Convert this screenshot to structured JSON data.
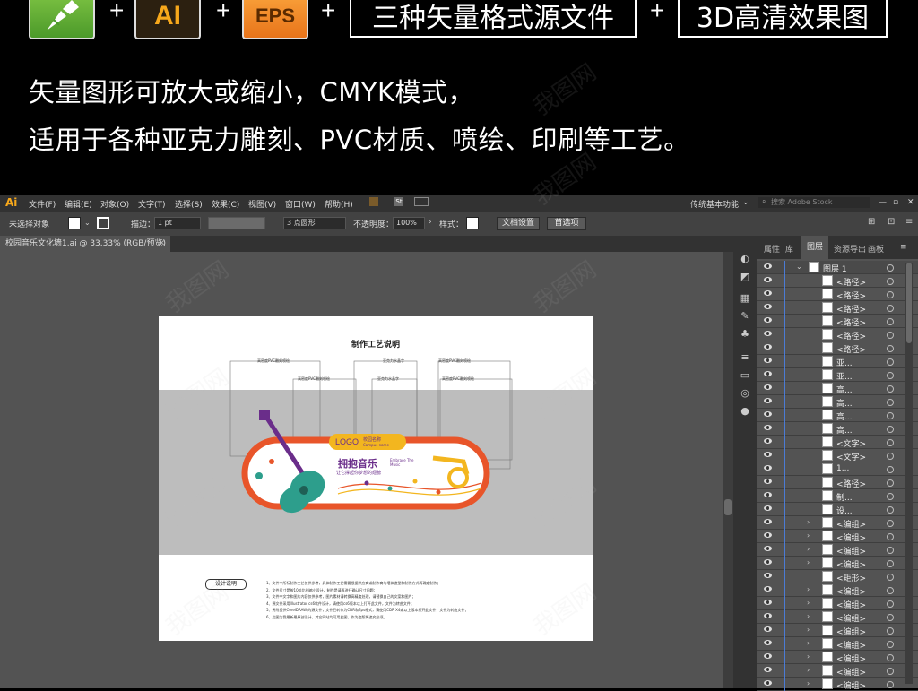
{
  "banner": {
    "icons": [
      "coreldraw-icon",
      "AI",
      "EPS"
    ],
    "plus": "+",
    "tag1": "三种矢量格式源文件",
    "tag2": "3D高清效果图",
    "line1": "矢量图形可放大或缩小，CMYK模式，",
    "line2": "适用于各种亚克力雕刻、PVC材质、喷绘、印刷等工艺。"
  },
  "app": {
    "logo": "Ai",
    "menu": [
      "文件(F)",
      "编辑(E)",
      "对象(O)",
      "文字(T)",
      "选择(S)",
      "效果(C)",
      "视图(V)",
      "窗口(W)",
      "帮助(H)"
    ],
    "workspace": "传统基本功能",
    "search_placeholder": "搜索 Adobe Stock",
    "control": {
      "selection": "未选择对象",
      "stroke_label": "描边：",
      "stroke_value": "1 pt",
      "brush_value": "3 点圆形",
      "opacity_label": "不透明度：",
      "opacity_value": "100%",
      "style_label": "样式：",
      "doc_settings": "文档设置",
      "preferences": "首选项"
    },
    "doc_tab": "校园音乐文化墙1.ai @ 33.33% (RGB/预览)",
    "panel_tabs": [
      "属性",
      "库",
      "图层",
      "资源导出",
      "画板"
    ],
    "layers": [
      {
        "name": "图层 1",
        "level": 0,
        "arrow": "⌄"
      },
      {
        "name": "<路径>",
        "level": 1
      },
      {
        "name": "<路径>",
        "level": 1
      },
      {
        "name": "<路径>",
        "level": 1
      },
      {
        "name": "<路径>",
        "level": 1
      },
      {
        "name": "<路径>",
        "level": 1
      },
      {
        "name": "<路径>",
        "level": 1
      },
      {
        "name": "亚...",
        "level": 1
      },
      {
        "name": "亚...",
        "level": 1
      },
      {
        "name": "高...",
        "level": 1
      },
      {
        "name": "高...",
        "level": 1
      },
      {
        "name": "高...",
        "level": 1
      },
      {
        "name": "高...",
        "level": 1
      },
      {
        "name": "<文字>",
        "level": 1
      },
      {
        "name": "<文字>",
        "level": 1
      },
      {
        "name": "1...",
        "level": 1
      },
      {
        "name": "<路径>",
        "level": 1
      },
      {
        "name": "制...",
        "level": 1
      },
      {
        "name": "设...",
        "level": 1
      },
      {
        "name": "<编组>",
        "level": 1,
        "arrow": "›"
      },
      {
        "name": "<编组>",
        "level": 1,
        "arrow": "›"
      },
      {
        "name": "<编组>",
        "level": 1,
        "arrow": "›"
      },
      {
        "name": "<编组>",
        "level": 1,
        "arrow": "›"
      },
      {
        "name": "<矩形>",
        "level": 1
      },
      {
        "name": "<编组>",
        "level": 1,
        "arrow": "›"
      },
      {
        "name": "<编组>",
        "level": 1,
        "arrow": "›"
      },
      {
        "name": "<编组>",
        "level": 1,
        "arrow": "›"
      },
      {
        "name": "<编组>",
        "level": 1,
        "arrow": "›"
      },
      {
        "name": "<编组>",
        "level": 1,
        "arrow": "›"
      },
      {
        "name": "<编组>",
        "level": 1,
        "arrow": "›"
      },
      {
        "name": "<编组>",
        "level": 1,
        "arrow": "›"
      },
      {
        "name": "<编组>",
        "level": 1,
        "arrow": "›"
      }
    ]
  },
  "artboard": {
    "title": "制作工艺说明",
    "callouts": [
      "高密度PVC雕刻喷绘",
      "高密度PVC雕刻喷绘",
      "亚克力水晶字",
      "亚克力水晶字",
      "高密度PVC雕刻喷绘",
      "高密度PVC雕刻喷绘"
    ],
    "logo": "LOGO",
    "school": "校园名称",
    "school_en": "Campus name",
    "headline": "拥抱音乐",
    "headline_en": "Embrace The Music",
    "slogan": "让它撑起你梦想的翅膀",
    "design_label": "设计说明",
    "notes": [
      "1、文件中所标制作工艺仅供参考，具体制作工艺需要根据供应商或制作商与墙体造型和制作方式再确定制作；",
      "2、文件尺寸是按10倍比例缩小设计，制作是请再进行确认尺寸问题；",
      "3、文件中文字和图片内容仅供参考，图片素材请转换高精度处理，请替换自己的文案和图片；",
      "4、源文件采用Illustrator cs6软件设计，请使用cs6版本以上打开此文件，文件为转曲文件；",
      "5、另附提供CorelDRAW 的源文件，文件已转存为CDR和Eps格式，请使用CDR X4或以上版本打开此文件，文件为转曲文件；",
      "6、此图为我最新最原创设计，其它网站均可用此图，作为盗版将追究必须。"
    ],
    "colors": {
      "orange": "#e8552a",
      "yellow": "#f3b61f",
      "teal": "#2d9e8c",
      "purple": "#6a2d8a",
      "gray": "#bdbdbd"
    }
  },
  "watermark": "我图网"
}
